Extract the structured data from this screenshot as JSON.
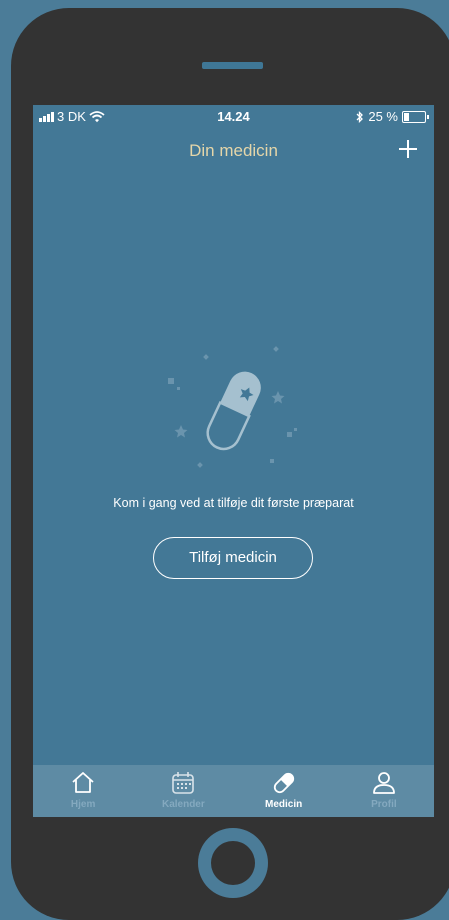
{
  "status_bar": {
    "carrier": "3 DK",
    "time": "14.24",
    "battery": "25 %",
    "battery_level": 0.25
  },
  "header": {
    "title": "Din medicin"
  },
  "empty_state": {
    "message": "Kom i gang ved at tilføje dit første præparat",
    "button_label": "Tilføj medicin"
  },
  "tabs": [
    {
      "label": "Hjem",
      "icon": "home-icon",
      "active": false
    },
    {
      "label": "Kalender",
      "icon": "calendar-icon",
      "active": false
    },
    {
      "label": "Medicin",
      "icon": "pill-icon",
      "active": true
    },
    {
      "label": "Profil",
      "icon": "profile-icon",
      "active": false
    }
  ],
  "colors": {
    "background": "#4b7c98",
    "phone_frame": "#333333",
    "screen": "#437896",
    "title": "#e5d6a9",
    "tabbar": "#5e8ba4",
    "tab_inactive": "#84a9bf",
    "tab_active": "#ffffff"
  }
}
